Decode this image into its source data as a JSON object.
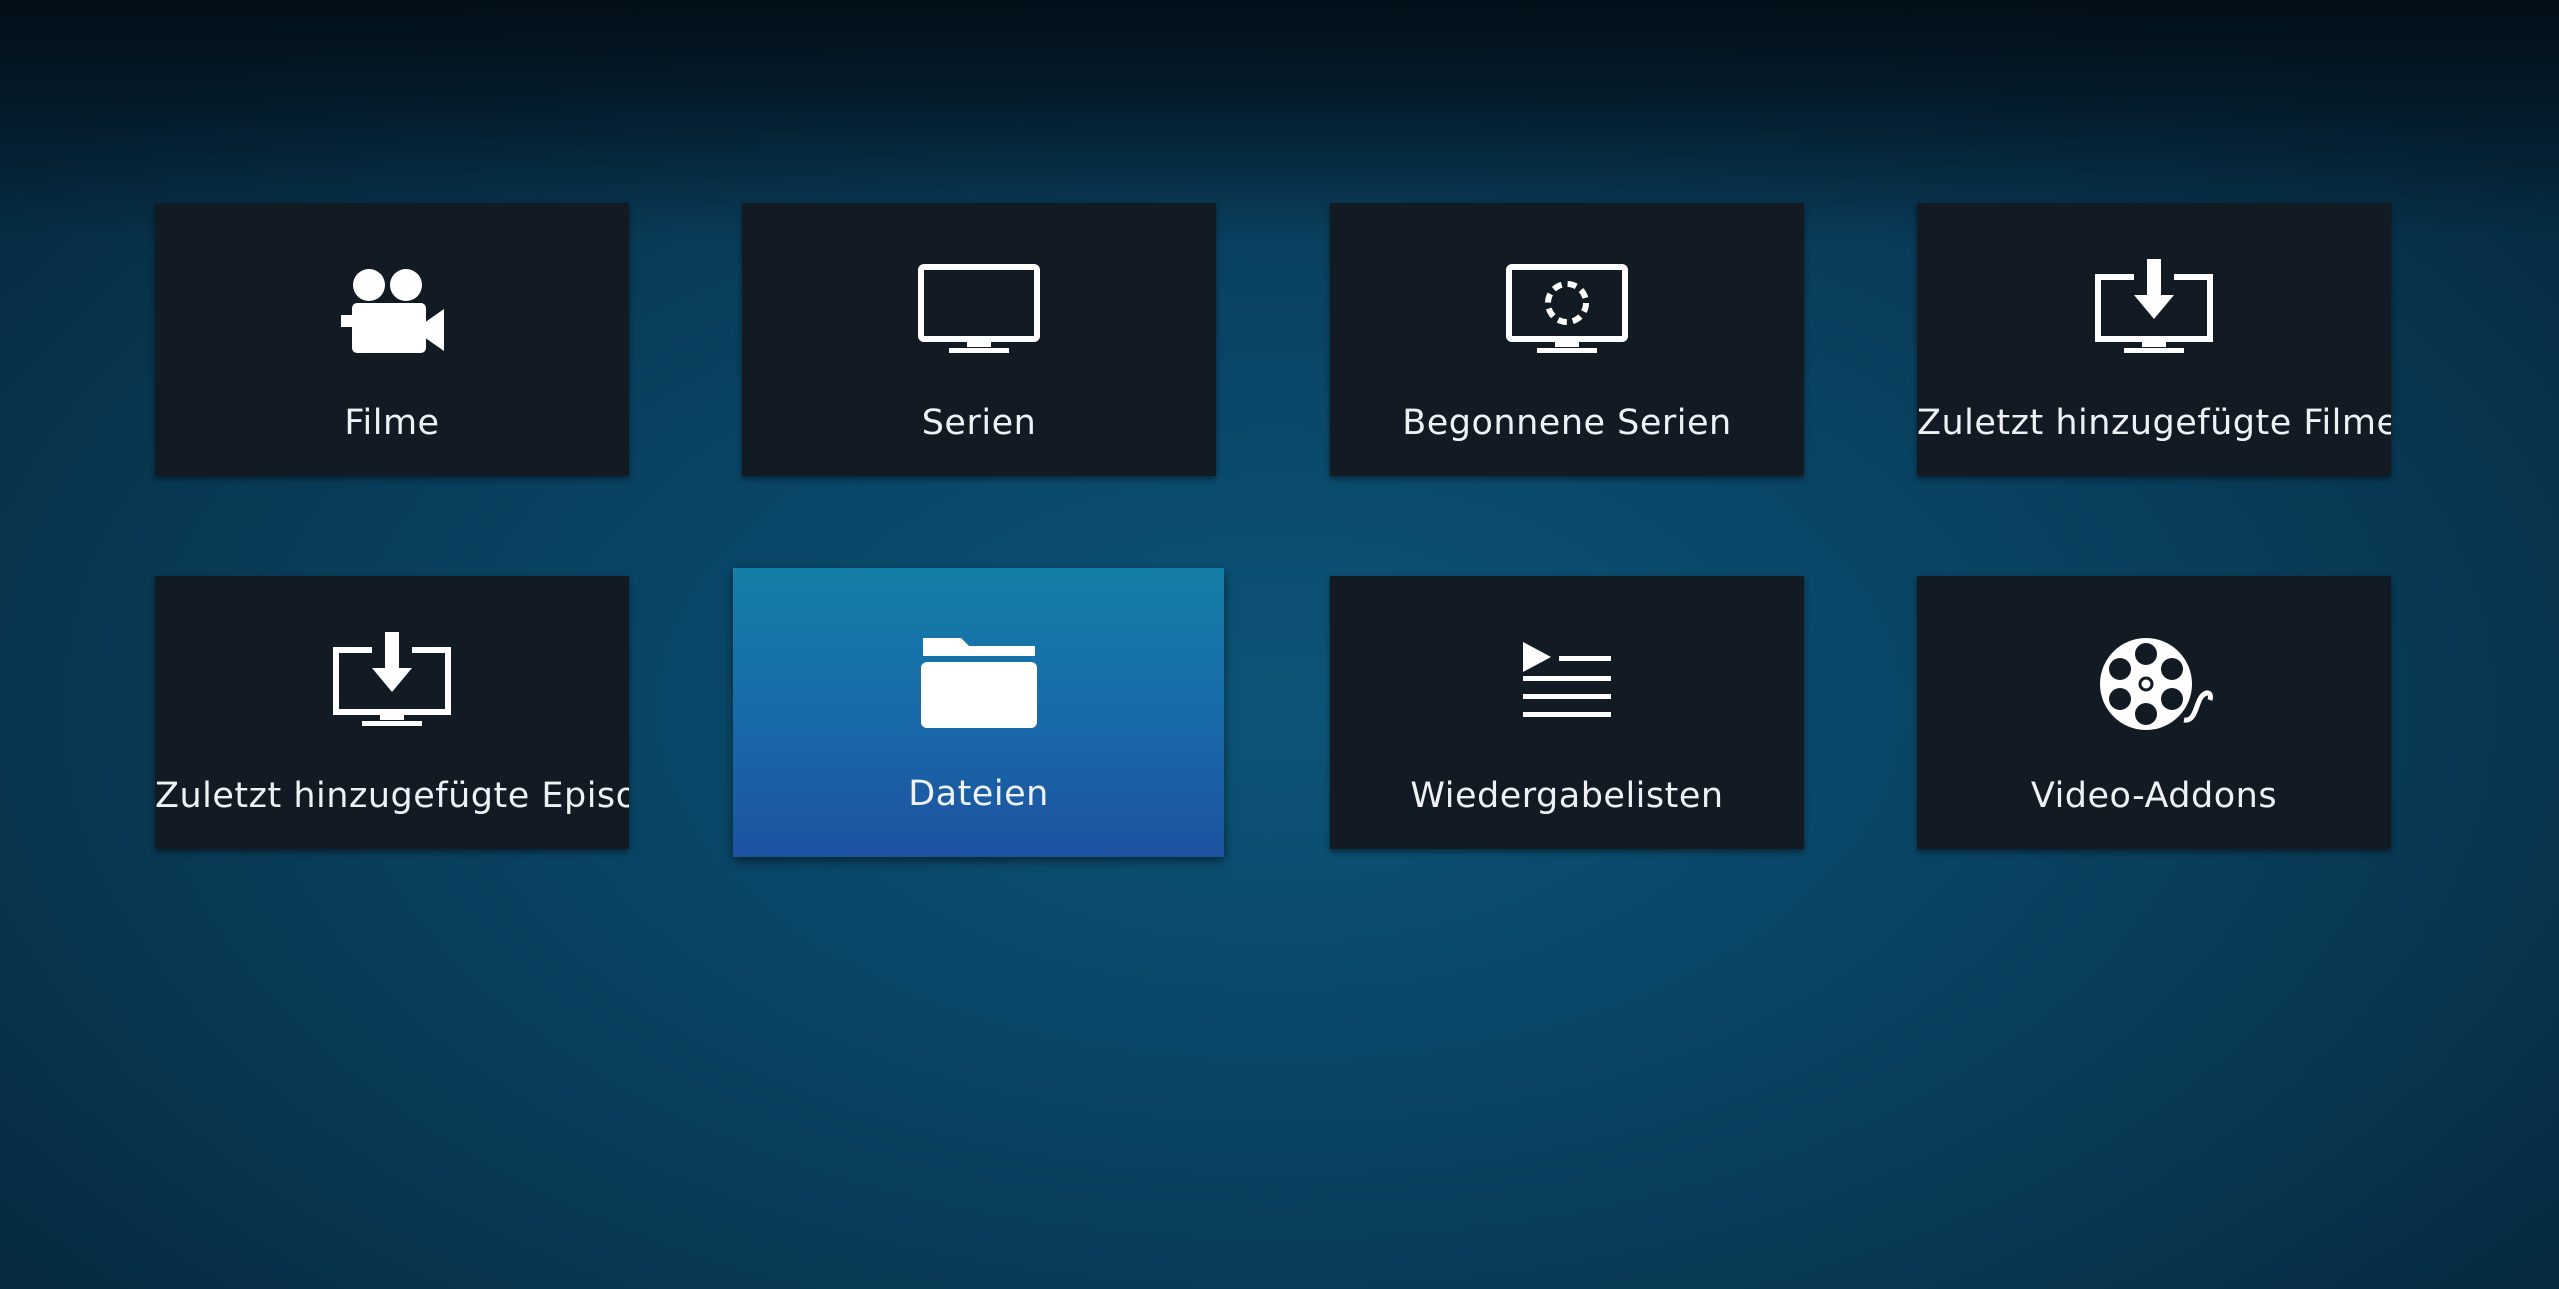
{
  "tiles": [
    {
      "id": "movies",
      "label": "Filme",
      "icon": "movie-camera-icon"
    },
    {
      "id": "tvshows",
      "label": "Serien",
      "icon": "tv-icon"
    },
    {
      "id": "inprogress",
      "label": "Begonnene Serien",
      "icon": "tv-progress-icon"
    },
    {
      "id": "recentmovies",
      "label": "Zuletzt hinzugefügte Filme",
      "icon": "tv-download-icon"
    },
    {
      "id": "recentepisodes",
      "label": "Zuletzt hinzugefügte Episoden",
      "icon": "tv-download-icon"
    },
    {
      "id": "files",
      "label": "Dateien",
      "icon": "folder-icon",
      "focused": true
    },
    {
      "id": "playlists",
      "label": "Wiedergabelisten",
      "icon": "playlist-icon"
    },
    {
      "id": "addons",
      "label": "Video-Addons",
      "icon": "film-reel-icon"
    }
  ],
  "colors": {
    "tile_bg": "#121b23",
    "focus_top": "#137fa8",
    "focus_bottom": "#1d52a0",
    "text": "#eef2f5"
  }
}
